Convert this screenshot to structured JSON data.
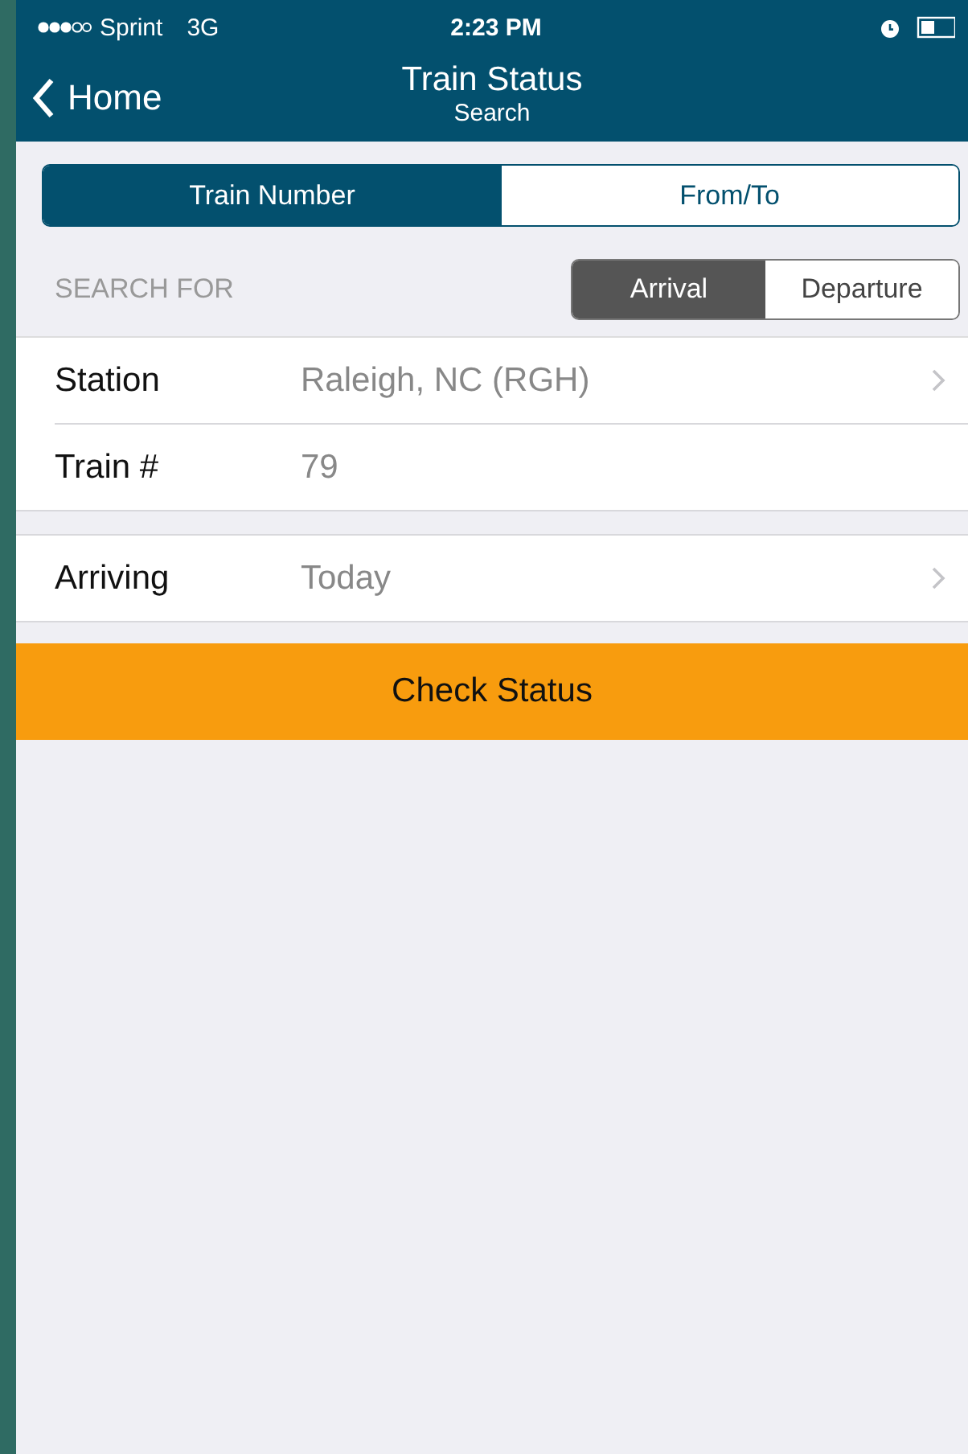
{
  "status_bar": {
    "carrier": "Sprint",
    "network": "3G",
    "time": "2:23 PM"
  },
  "nav_bar": {
    "back": "Home",
    "title": "Train Status",
    "subtitle": "Search"
  },
  "tabs": [
    {
      "label": "Train Number",
      "selected": true
    },
    {
      "label": "From/To",
      "selected": false
    }
  ],
  "search_for": {
    "label": "SEARCH FOR",
    "options": [
      {
        "label": "Arrival",
        "selected": true
      },
      {
        "label": "Departure",
        "selected": false
      }
    ]
  },
  "groups": [
    {
      "rows": [
        {
          "kind": "disclosure",
          "label": "Station",
          "value": "Raleigh, NC (RGH)"
        },
        {
          "kind": "plain",
          "label": "Train #",
          "value": "79"
        }
      ]
    },
    {
      "rows": [
        {
          "kind": "disclosure",
          "label": "Arriving",
          "value": "Today"
        }
      ]
    }
  ],
  "action_button": "Check Status"
}
